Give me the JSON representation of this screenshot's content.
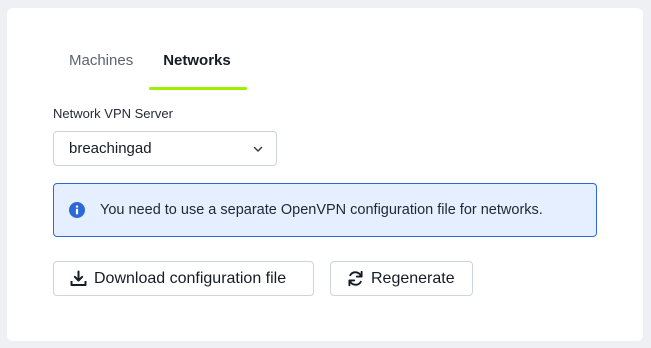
{
  "tabs": [
    {
      "label": "Machines",
      "active": false
    },
    {
      "label": "Networks",
      "active": true
    }
  ],
  "network": {
    "label": "Network VPN Server",
    "selected": "breachingad"
  },
  "alert": {
    "message": "You need to use a separate OpenVPN configuration file for networks."
  },
  "actions": {
    "download_label": "Download configuration file",
    "regenerate_label": "Regenerate"
  },
  "icons": {
    "select": "chevron-down-icon",
    "alert": "info-circle-icon",
    "download": "download-icon",
    "regenerate": "refresh-icon"
  },
  "colors": {
    "tab_indicator": "#9fef00",
    "alert_border": "#2d69d6",
    "alert_bg": "#e5efff"
  }
}
